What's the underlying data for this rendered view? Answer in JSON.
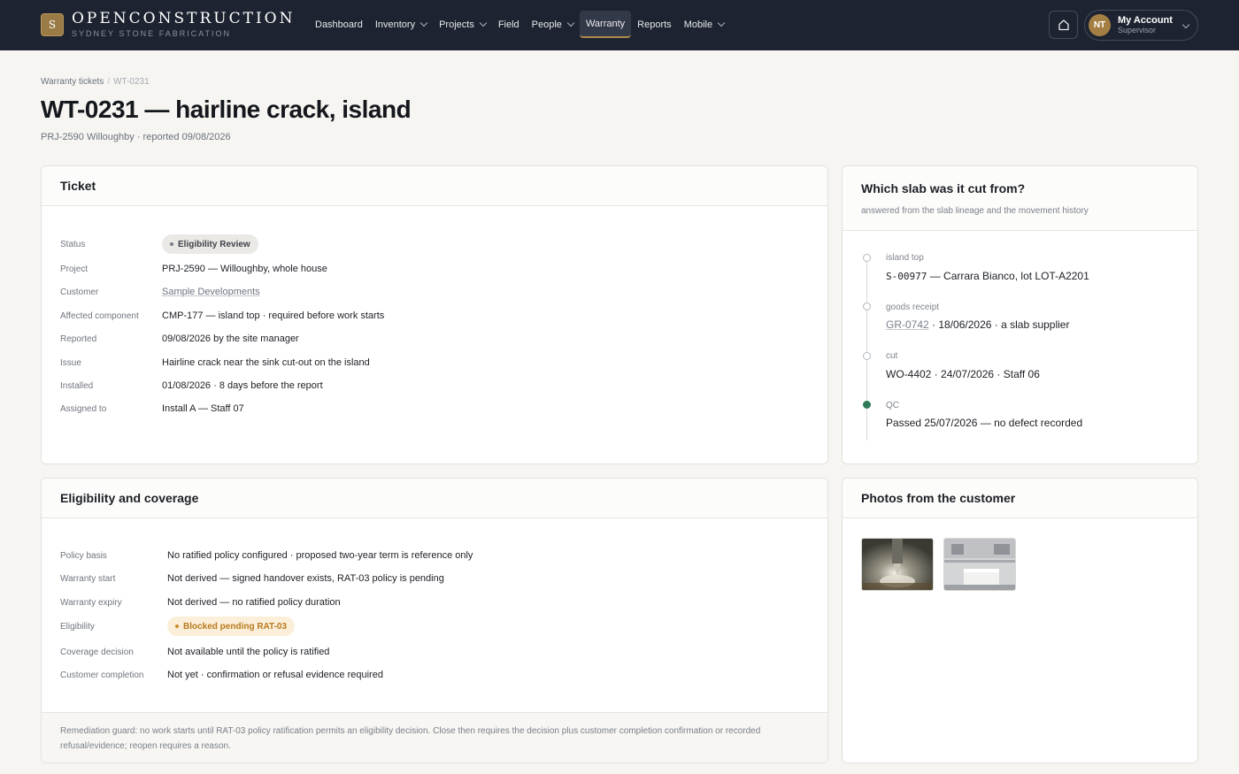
{
  "brand": {
    "mark": "S",
    "title": "OPENCONSTRUCTION",
    "subtitle": "SYDNEY STONE FABRICATION"
  },
  "nav": {
    "items": [
      {
        "label": "Dashboard",
        "dropdown": false
      },
      {
        "label": "Inventory",
        "dropdown": true
      },
      {
        "label": "Projects",
        "dropdown": true
      },
      {
        "label": "Field",
        "dropdown": false
      },
      {
        "label": "People",
        "dropdown": true
      },
      {
        "label": "Warranty",
        "dropdown": false,
        "active": true
      },
      {
        "label": "Reports",
        "dropdown": false
      },
      {
        "label": "Mobile",
        "dropdown": true
      }
    ],
    "home_icon": "home-icon"
  },
  "account": {
    "initials": "NT",
    "name": "My Account",
    "role": "Supervisor"
  },
  "breadcrumb": {
    "parent": "Warranty tickets",
    "separator": "/",
    "current": "WT-0231"
  },
  "page": {
    "title": "WT-0231 — hairline crack, island",
    "subtitle": "PRJ-2590 Willoughby · reported 09/08/2026"
  },
  "ticket": {
    "title": "Ticket",
    "status_label": "Status",
    "status_value": "Eligibility Review",
    "rows": [
      {
        "label": "Project",
        "value": "PRJ-2590 — Willoughby, whole house"
      },
      {
        "label": "Customer",
        "value": "Sample Developments",
        "link": true
      },
      {
        "label": "Affected component",
        "value": "CMP-177 — island top · required before work starts"
      },
      {
        "label": "Reported",
        "value": "09/08/2026 by the site manager"
      },
      {
        "label": "Issue",
        "value": "Hairline crack near the sink cut-out on the island"
      },
      {
        "label": "Installed",
        "value": "01/08/2026 · 8 days before the report"
      },
      {
        "label": "Assigned to",
        "value": "Install A — Staff 07"
      }
    ]
  },
  "slab": {
    "title": "Which slab was it cut from?",
    "subtitle": "answered from the slab lineage and the movement history",
    "steps": [
      {
        "label": "island top",
        "code": "S-00977",
        "text": " — Carrara Bianco, lot LOT-A2201",
        "done": false
      },
      {
        "label": "goods receipt",
        "code": "GR-0742",
        "text": " · 18/06/2026 · a slab supplier",
        "done": false,
        "link": true
      },
      {
        "label": "cut",
        "code": "",
        "text": "WO-4402 · 24/07/2026 · Staff 06",
        "done": false
      },
      {
        "label": "QC",
        "code": "",
        "text": "Passed 25/07/2026 — no defect recorded",
        "done": true
      }
    ]
  },
  "eligibility": {
    "title": "Eligibility and coverage",
    "rows": [
      {
        "label": "Policy basis",
        "value": "No ratified policy configured · proposed two-year term is reference only"
      },
      {
        "label": "Warranty start",
        "value": "Not derived — signed handover exists, RAT-03 policy is pending"
      },
      {
        "label": "Warranty expiry",
        "value": "Not derived — no ratified policy duration"
      },
      {
        "label": "Eligibility",
        "value": "Blocked pending RAT-03",
        "pill": true
      },
      {
        "label": "Coverage decision",
        "value": "Not available until the policy is ratified"
      },
      {
        "label": "Customer completion",
        "value": "Not yet · confirmation or refusal evidence required"
      }
    ],
    "footnote": "Remediation guard: no work starts until RAT-03 policy ratification permits an eligibility decision. Close then requires the decision plus customer completion confirmation or recorded refusal/evidence; reopen requires a reason."
  },
  "photos": {
    "title": "Photos from the customer",
    "items": [
      {
        "name": "photo-drill"
      },
      {
        "name": "photo-kitchen"
      }
    ]
  },
  "colors": {
    "nav_bg": "#1d2330",
    "accent": "#b08a4e",
    "qc_pass": "#2f7a58",
    "amber": "#b87a1f"
  }
}
